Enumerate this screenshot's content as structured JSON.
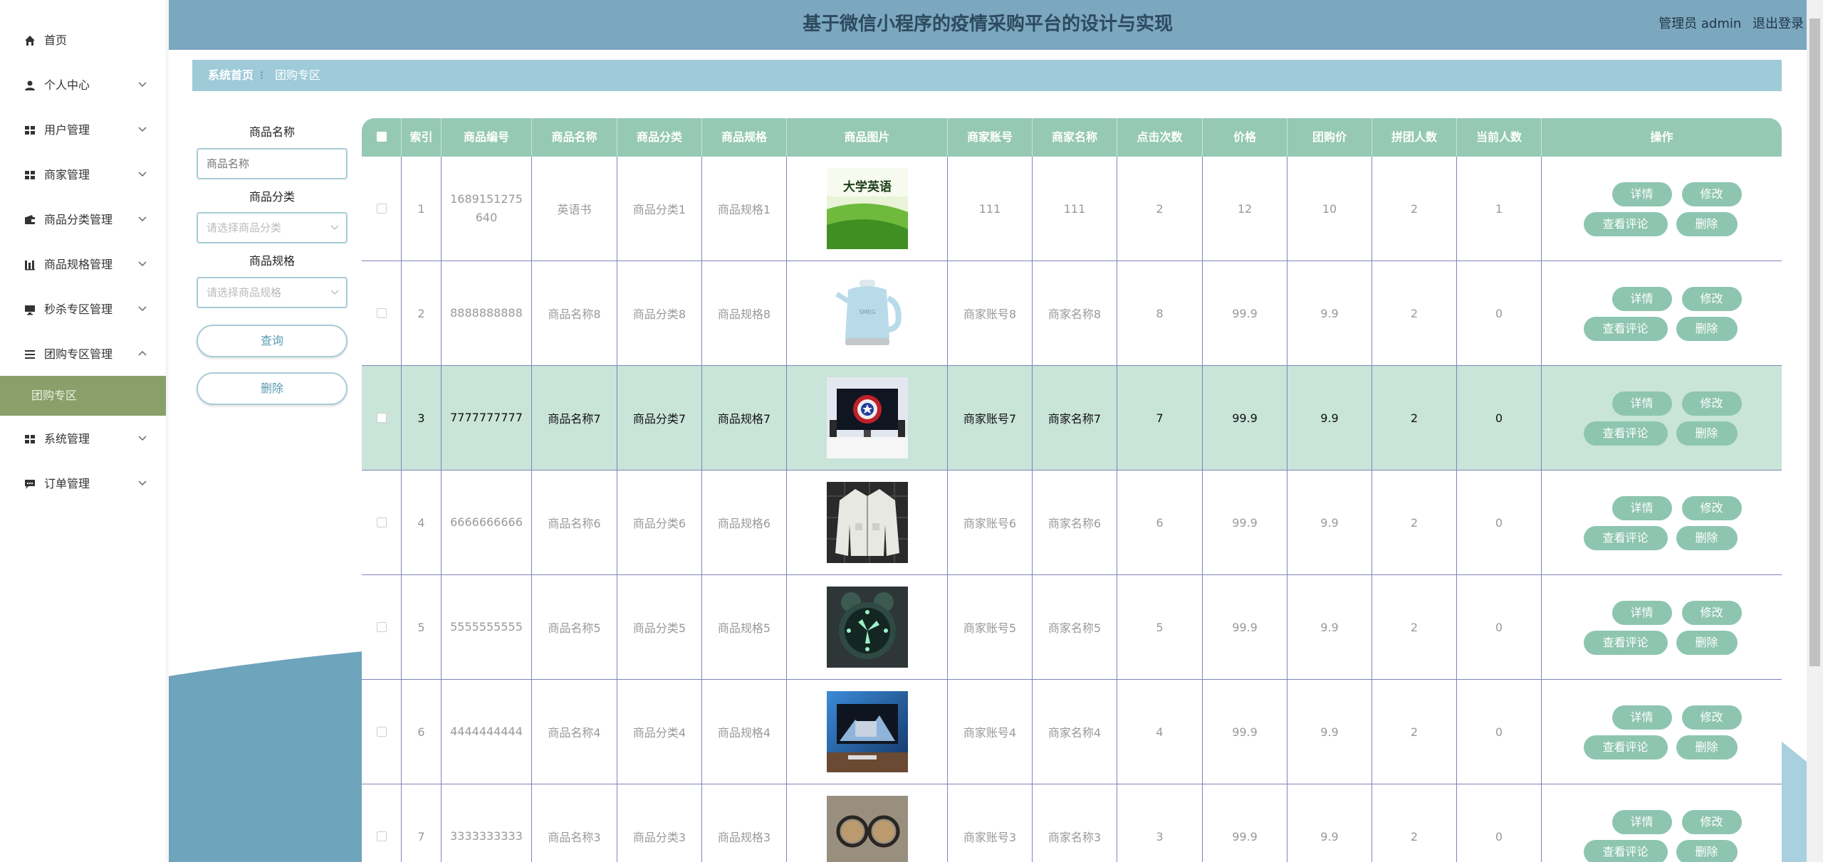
{
  "header": {
    "title": "基于微信小程序的疫情采购平台的设计与实现",
    "user_role": "管理员",
    "username": "admin",
    "logout_label": "退出登录"
  },
  "sidebar": {
    "items": [
      {
        "label": "首页",
        "icon": "home-icon"
      },
      {
        "label": "个人中心",
        "icon": "user-icon"
      },
      {
        "label": "用户管理",
        "icon": "grid-icon"
      },
      {
        "label": "商家管理",
        "icon": "grid-icon"
      },
      {
        "label": "商品分类管理",
        "icon": "wallet-icon"
      },
      {
        "label": "商品规格管理",
        "icon": "chart-icon"
      },
      {
        "label": "秒杀专区管理",
        "icon": "monitor-icon"
      },
      {
        "label": "团购专区管理",
        "icon": "list-icon"
      },
      {
        "label": "系统管理",
        "icon": "grid-icon"
      },
      {
        "label": "订单管理",
        "icon": "chat-icon"
      }
    ],
    "active_sub": "团购专区"
  },
  "breadcrumb": {
    "home": "系统首页",
    "separator": "⁝",
    "current": "团购专区"
  },
  "search": {
    "name_label": "商品名称",
    "name_placeholder": "商品名称",
    "category_label": "商品分类",
    "category_placeholder": "请选择商品分类",
    "spec_label": "商品规格",
    "spec_placeholder": "请选择商品规格",
    "query_label": "查询",
    "delete_label": "删除"
  },
  "table": {
    "headers": [
      "索引",
      "商品编号",
      "商品名称",
      "商品分类",
      "商品规格",
      "商品图片",
      "商家账号",
      "商家名称",
      "点击次数",
      "价格",
      "团购价",
      "拼团人数",
      "当前人数",
      "操作"
    ],
    "actions": {
      "detail": "详情",
      "edit": "修改",
      "review": "查看评论",
      "delete": "删除"
    },
    "rows": [
      {
        "index": "1",
        "code": "1689151275640",
        "name": "英语书",
        "category": "商品分类1",
        "spec": "商品规格1",
        "image": "book-image",
        "merchant_account": "111",
        "merchant_name": "111",
        "clicks": "2",
        "price": "12",
        "group_price": "10",
        "group_size": "2",
        "current": "1"
      },
      {
        "index": "2",
        "code": "8888888888",
        "name": "商品名称8",
        "category": "商品分类8",
        "spec": "商品规格8",
        "image": "kettle-image",
        "merchant_account": "商家账号8",
        "merchant_name": "商家名称8",
        "clicks": "8",
        "price": "99.9",
        "group_price": "9.9",
        "group_size": "2",
        "current": "0"
      },
      {
        "index": "3",
        "code": "7777777777",
        "name": "商品名称7",
        "category": "商品分类7",
        "spec": "商品规格7",
        "image": "monitor-image",
        "merchant_account": "商家账号7",
        "merchant_name": "商家名称7",
        "clicks": "7",
        "price": "99.9",
        "group_price": "9.9",
        "group_size": "2",
        "current": "0"
      },
      {
        "index": "4",
        "code": "6666666666",
        "name": "商品名称6",
        "category": "商品分类6",
        "spec": "商品规格6",
        "image": "jacket-image",
        "merchant_account": "商家账号6",
        "merchant_name": "商家名称6",
        "clicks": "6",
        "price": "99.9",
        "group_price": "9.9",
        "group_size": "2",
        "current": "0"
      },
      {
        "index": "5",
        "code": "5555555555",
        "name": "商品名称5",
        "category": "商品分类5",
        "spec": "商品规格5",
        "image": "clock-image",
        "merchant_account": "商家账号5",
        "merchant_name": "商家名称5",
        "clicks": "5",
        "price": "99.9",
        "group_price": "9.9",
        "group_size": "2",
        "current": "0"
      },
      {
        "index": "6",
        "code": "4444444444",
        "name": "商品名称4",
        "category": "商品分类4",
        "spec": "商品规格4",
        "image": "tv-image",
        "merchant_account": "商家账号4",
        "merchant_name": "商家名称4",
        "clicks": "4",
        "price": "99.9",
        "group_price": "9.9",
        "group_size": "2",
        "current": "0"
      },
      {
        "index": "7",
        "code": "3333333333",
        "name": "商品名称3",
        "category": "商品分类3",
        "spec": "商品规格3",
        "image": "glasses-image",
        "merchant_account": "商家账号3",
        "merchant_name": "商家名称3",
        "clicks": "3",
        "price": "99.9",
        "group_price": "9.9",
        "group_size": "2",
        "current": "0"
      }
    ],
    "highlighted_row": 3
  },
  "colors": {
    "header_bg": "#7ba7bf",
    "breadcrumb_bg": "#9fcbd8",
    "table_header_bg": "#95c9b4",
    "action_button": "#8ec5b0",
    "sidebar_active": "#8aa06a",
    "row_highlight": "#c9e4d9"
  }
}
